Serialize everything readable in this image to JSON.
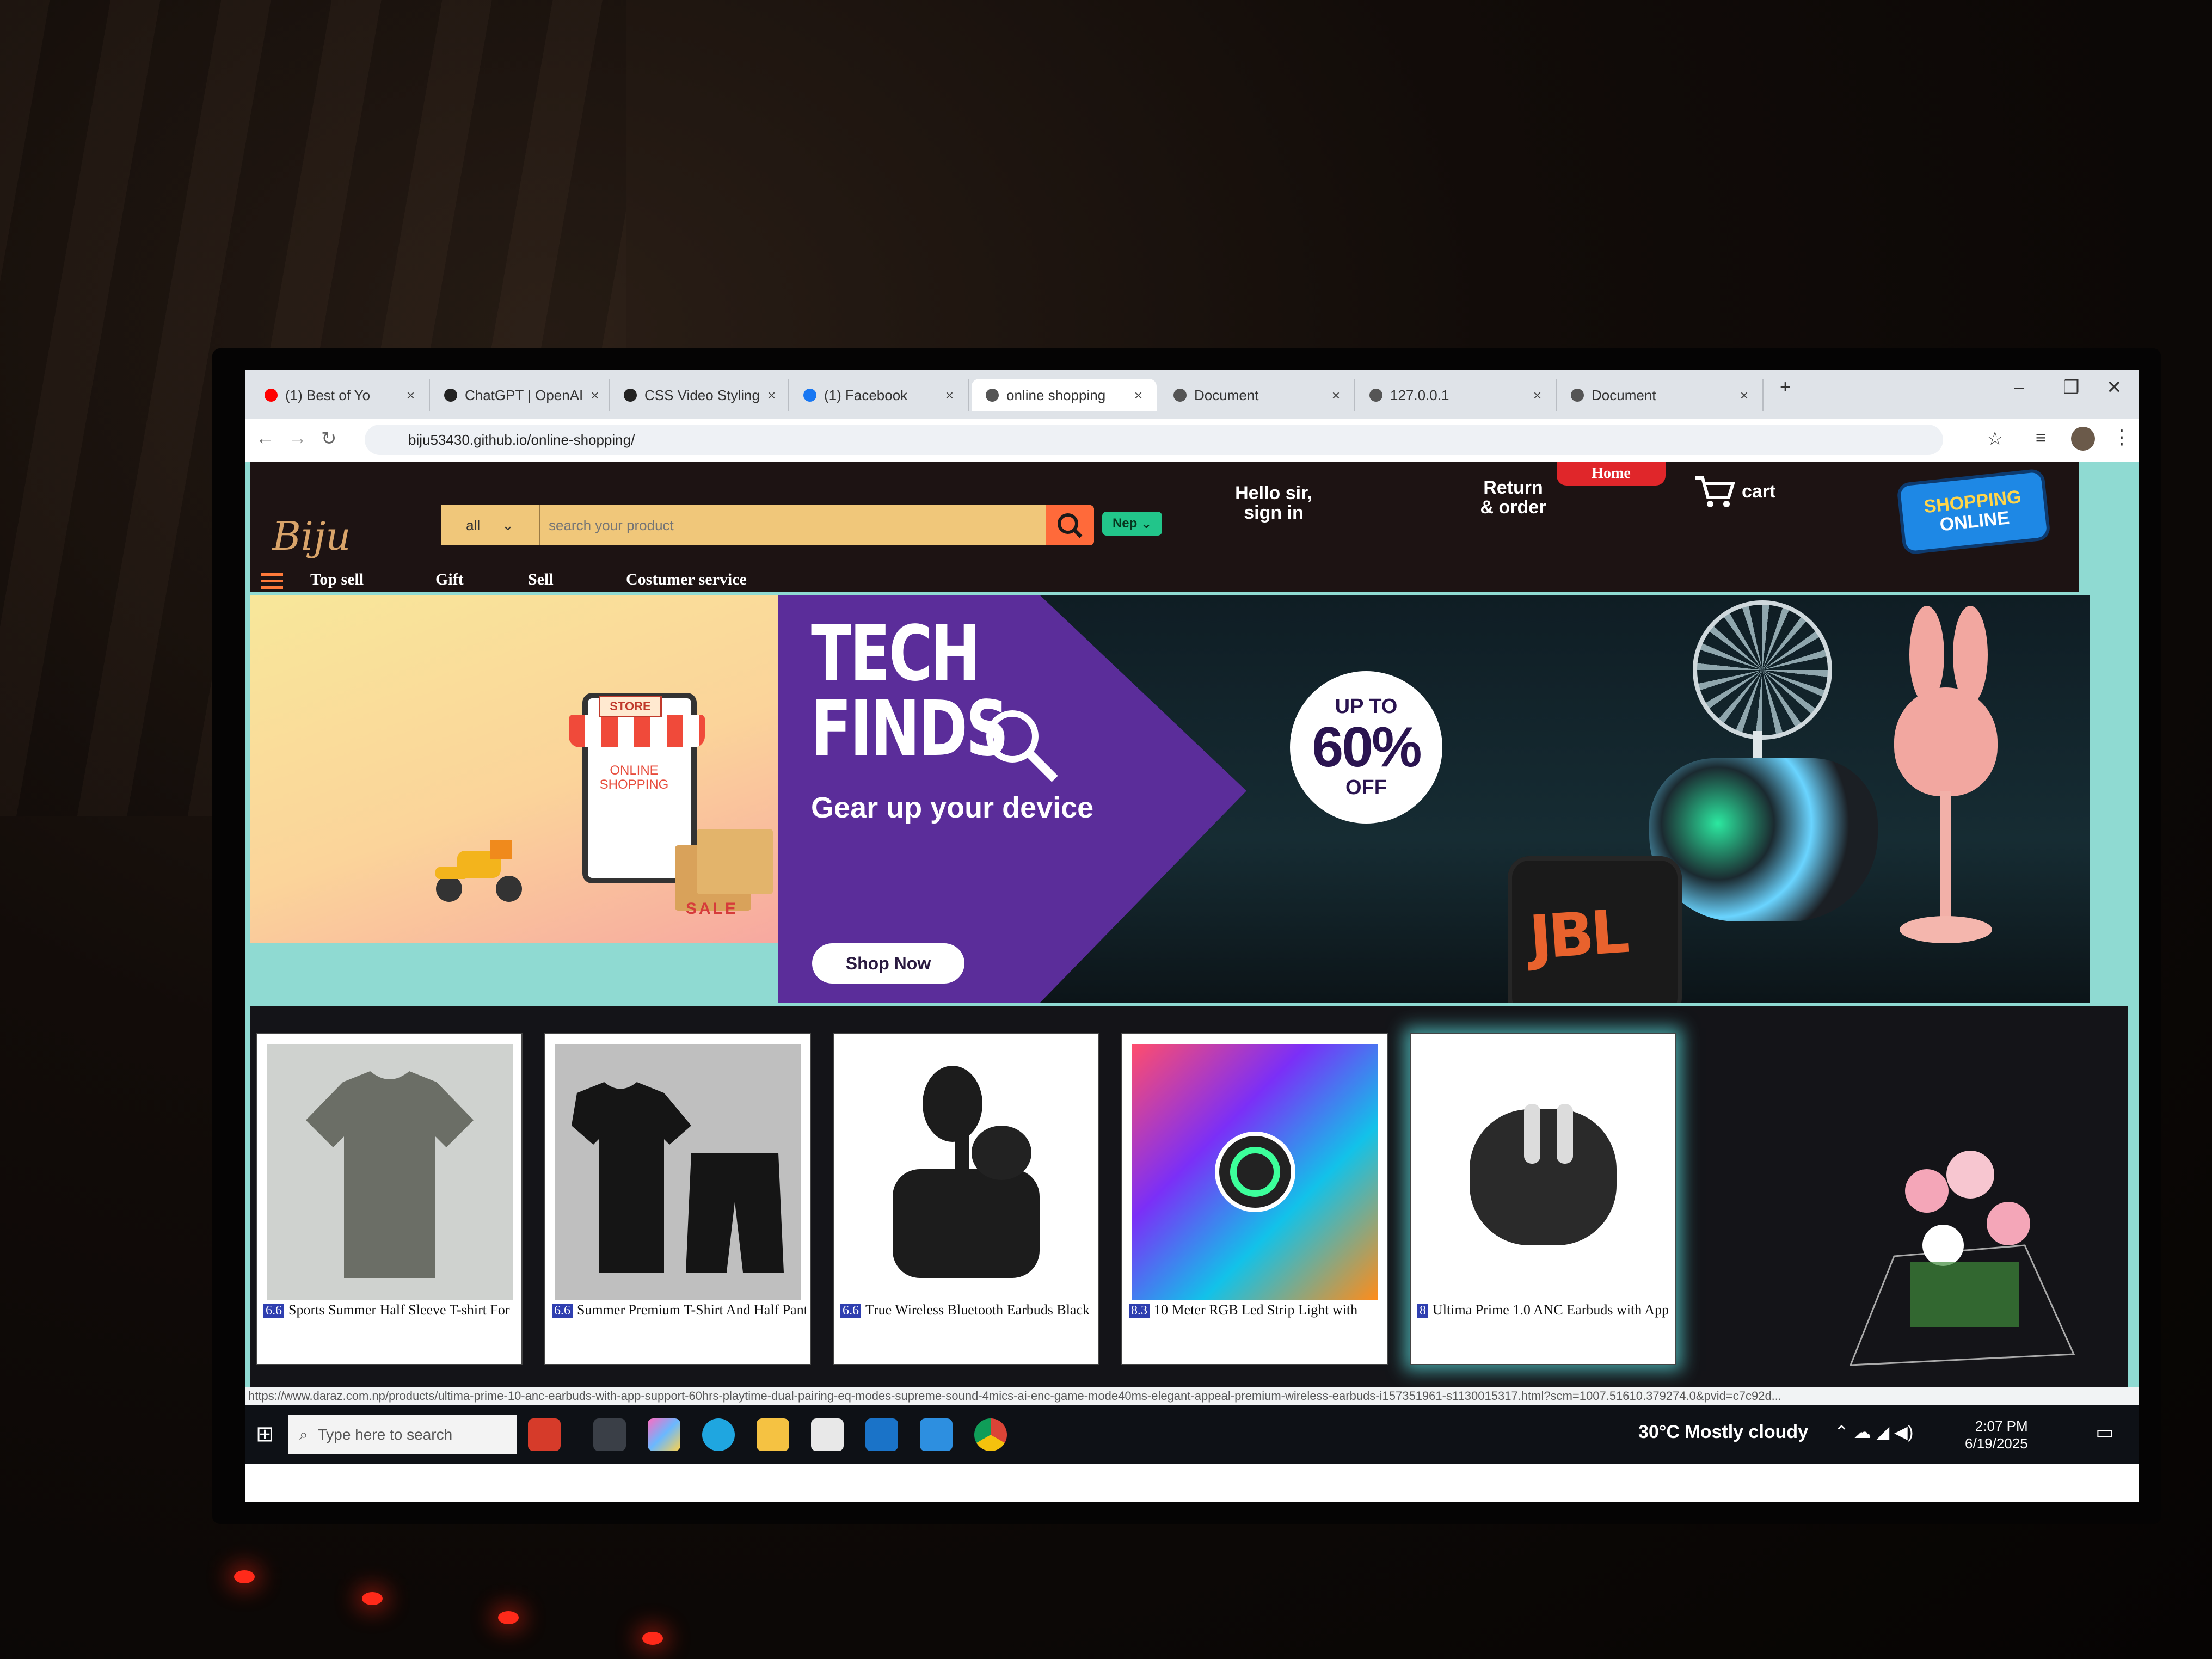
{
  "browser": {
    "tabs": [
      {
        "label": "(1) Best of Yo",
        "favicon_color": "#ff0000"
      },
      {
        "label": "ChatGPT | OpenAI",
        "favicon_color": "#222222"
      },
      {
        "label": "CSS Video Styling",
        "favicon_color": "#222222"
      },
      {
        "label": "(1) Facebook",
        "favicon_color": "#1877f2"
      },
      {
        "label": "online shopping",
        "favicon_color": "#555555"
      },
      {
        "label": "Document",
        "favicon_color": "#555555"
      },
      {
        "label": "127.0.0.1",
        "favicon_color": "#555555"
      },
      {
        "label": "Document",
        "favicon_color": "#555555"
      }
    ],
    "close_glyph": "×",
    "new_tab_glyph": "+",
    "url": "biju53430.github.io/online-shopping/"
  },
  "site": {
    "logo": "Biju",
    "search": {
      "category": "all",
      "placeholder": "search your product"
    },
    "language": "Nep",
    "greeting_line1": "Hello sir,",
    "greeting_line2": "sign in",
    "home": "Home",
    "returns_line1": "Return",
    "returns_line2": "& order",
    "cart": "cart",
    "badge_line1": "SHOPPING",
    "badge_line2": "ONLINE",
    "menu": [
      "Top sell",
      "Gift",
      "Sell",
      "Costumer service"
    ]
  },
  "hero": {
    "left_store_sign": "STORE",
    "left_online_text": "ONLINE SHOPPING",
    "left_sale": "SALE",
    "headline_line1": "TECH",
    "headline_line2": "FINDS",
    "subhead": "Gear up your device",
    "cta": "Shop Now",
    "discount_top": "UP TO",
    "discount_value": "60%",
    "discount_bottom": "OFF",
    "speaker_brand": "JBL"
  },
  "products": [
    {
      "rating": "6.6",
      "title": "Sports Summer Half Sleeve T-shirt For"
    },
    {
      "rating": "6.6",
      "title": "Summer Premium T-Shirt And Half Pant"
    },
    {
      "rating": "6.6",
      "title": "True Wireless Bluetooth Earbuds Black"
    },
    {
      "rating": "8.3",
      "title": "10 Meter RGB Led Strip Light with"
    },
    {
      "rating": "8",
      "title": "Ultima Prime 1.0 ANC Earbuds with App"
    }
  ],
  "status_url": "https://www.daraz.com.np/products/ultima-prime-10-anc-earbuds-with-app-support-60hrs-playtime-dual-pairing-eq-modes-supreme-sound-4mics-ai-enc-game-mode40ms-elegant-appeal-premium-wireless-earbuds-i157351961-s1130015317.html?scm=1007.51610.379274.0&pvid=c7c92d...",
  "taskbar": {
    "search_placeholder": "Type here to search",
    "weather": "30°C  Mostly cloudy",
    "time": "2:07 PM",
    "date": "6/19/2025"
  },
  "colors": {
    "nav_bg": "#1d1313",
    "search_bg": "#f0c77a",
    "search_button": "#ff6a3a",
    "hero_purple": "#5b2d9a",
    "page_teal": "#8fdad2",
    "rating_badge": "#2f3fb0"
  }
}
